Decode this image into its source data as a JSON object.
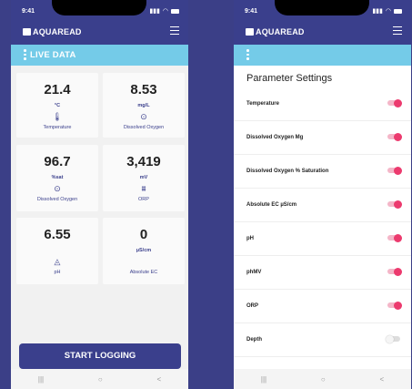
{
  "status_bar": {
    "time": "9:41"
  },
  "app": {
    "logo_text": "AQUAREAD"
  },
  "live_screen": {
    "subtitle": "LIVE DATA",
    "tiles": [
      {
        "value": "21.4",
        "unit": "°C",
        "icon": "thermometer-icon",
        "label": "Temperature"
      },
      {
        "value": "8.53",
        "unit": "mg/L",
        "icon": "oxygen-sensor-icon",
        "label": "Dissolved Oxygen"
      },
      {
        "value": "96.7",
        "unit": "%sat",
        "icon": "oxygen-sensor-icon",
        "label": "Dissolved Oxygen"
      },
      {
        "value": "3,419",
        "unit": "mV",
        "icon": "orp-icon",
        "label": "ORP"
      },
      {
        "value": "6.55",
        "unit": "",
        "icon": "droplet-icon",
        "label": "pH"
      },
      {
        "value": "0",
        "unit": "µS/cm",
        "icon": "",
        "label": "Absolute EC"
      }
    ],
    "start_button": "START LOGGING"
  },
  "settings_screen": {
    "title": "Parameter Settings",
    "items": [
      {
        "label": "Temperature",
        "enabled": true
      },
      {
        "label": "Dissolved Oxygen Mg",
        "enabled": true
      },
      {
        "label": "Dissolved Oxygen % Saturation",
        "enabled": true
      },
      {
        "label": "Absolute EC µS/cm",
        "enabled": true
      },
      {
        "label": "pH",
        "enabled": true
      },
      {
        "label": "phMV",
        "enabled": true
      },
      {
        "label": "ORP",
        "enabled": true
      },
      {
        "label": "Depth",
        "enabled": false
      }
    ]
  },
  "nav_bar": {
    "recents": "|||",
    "home": "○",
    "back": "<"
  },
  "colors": {
    "header": "#3a3f8c",
    "subheader": "#74cbe8",
    "toggle_on": "#ec3a6e",
    "background": "#3b3f87"
  }
}
